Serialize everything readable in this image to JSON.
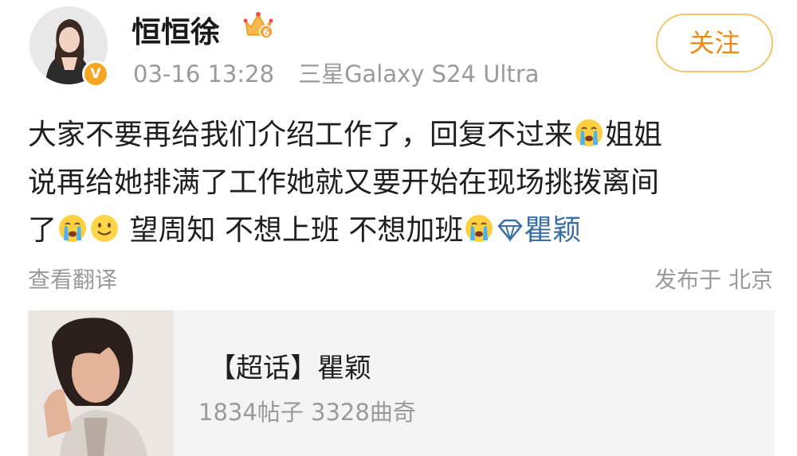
{
  "post": {
    "username": "恒恒徐",
    "verified_badge": "V",
    "crown_level": "6",
    "timestamp": "03-16 13:28",
    "device": "三星Galaxy S24 Ultra",
    "follow_label": "关注",
    "text_lines": [
      [
        "大家不要再给我们介绍工作了，回复不过来",
        "姐姐"
      ],
      [
        "说再给她排满了工作她就又要开始在现场挑拨离间"
      ],
      [
        "了",
        " 望周知 不想上班 不想加班",
        "瞿颖"
      ]
    ],
    "translate_label": "查看翻译",
    "location_label": "发布于 北京"
  },
  "topic_card": {
    "title": "【超话】瞿颖",
    "stats": "1834帖子 3328曲奇"
  },
  "colors": {
    "accent_orange": "#ee8a14",
    "link_blue": "#3a6ea5",
    "meta_gray": "#9a9a9a",
    "badge_gold": "#f5a623"
  },
  "icons": {
    "emojis": [
      "crying-face-icon",
      "smiling-face-icon",
      "diamond-icon",
      "crown-icon"
    ]
  }
}
